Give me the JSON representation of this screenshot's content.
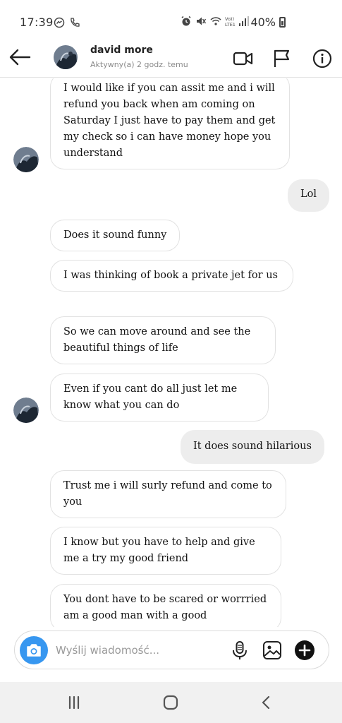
{
  "status_bar": {
    "time": "17:39",
    "battery": "40%"
  },
  "header": {
    "contact_name": "david more",
    "contact_status": "Aktywny(a) 2 godz. temu"
  },
  "messages": [
    {
      "from": "them",
      "text": "I would like if you can assit me and i will refund you back when am coming on Saturday  I just have to pay them and get my check so i can have money hope you understand"
    },
    {
      "from": "me",
      "text": "Lol"
    },
    {
      "from": "them",
      "text": "Does it sound funny"
    },
    {
      "from": "them",
      "text": "I was thinking of book a private jet for us"
    },
    {
      "from": "them",
      "text": "So we can move around and see the beautiful things of life"
    },
    {
      "from": "them",
      "text": "Even if you cant do all just let me know what you can do"
    },
    {
      "from": "me",
      "text": "It does sound hilarious"
    },
    {
      "from": "them",
      "text": "Trust me i will surly refund and come to you"
    },
    {
      "from": "them",
      "text": "I know but you have to help and give me a try my good friend"
    },
    {
      "from": "them",
      "text": "You dont have to be scared or worrried am a good man with a good"
    }
  ],
  "composer": {
    "placeholder": "Wyślij wiadomość..."
  },
  "colors": {
    "accent": "#3797f0",
    "sent_bubble": "#ededed",
    "received_border": "#e2e2e2"
  }
}
